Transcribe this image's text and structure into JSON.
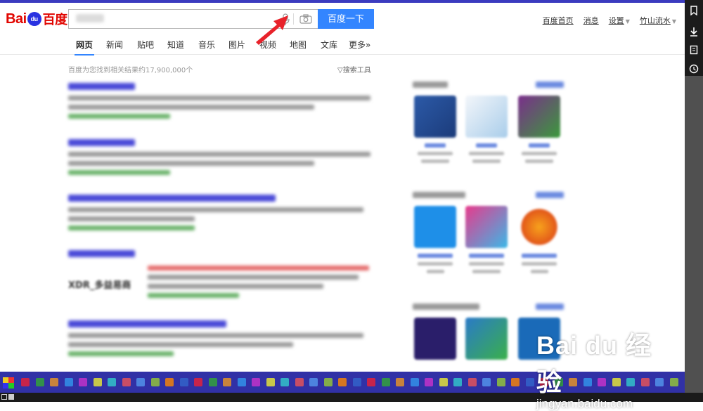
{
  "header": {
    "logo_text": "Bai",
    "logo_paw": "du",
    "logo_cn": "百度",
    "search_button": "百度一下",
    "top_links": [
      "百度首页",
      "消息",
      "设置",
      "竹山流水"
    ]
  },
  "tabs": [
    "网页",
    "新闻",
    "贴吧",
    "知道",
    "音乐",
    "图片",
    "视频",
    "地图",
    "文库",
    "更多»"
  ],
  "results": {
    "count_text": "百度为您找到相关结果约17,900,000个",
    "tools_text": "搜索工具"
  },
  "thumb_text": "XDR_多益易商",
  "watermark": {
    "big": "Bai du 经验",
    "small": "jingyan.baidu.com"
  },
  "colors": {
    "accent": "#3385ff",
    "brand_red": "#e10601",
    "brand_blue": "#2932e1",
    "taskbar": "#3131a6",
    "arrow": "#e8222a"
  }
}
